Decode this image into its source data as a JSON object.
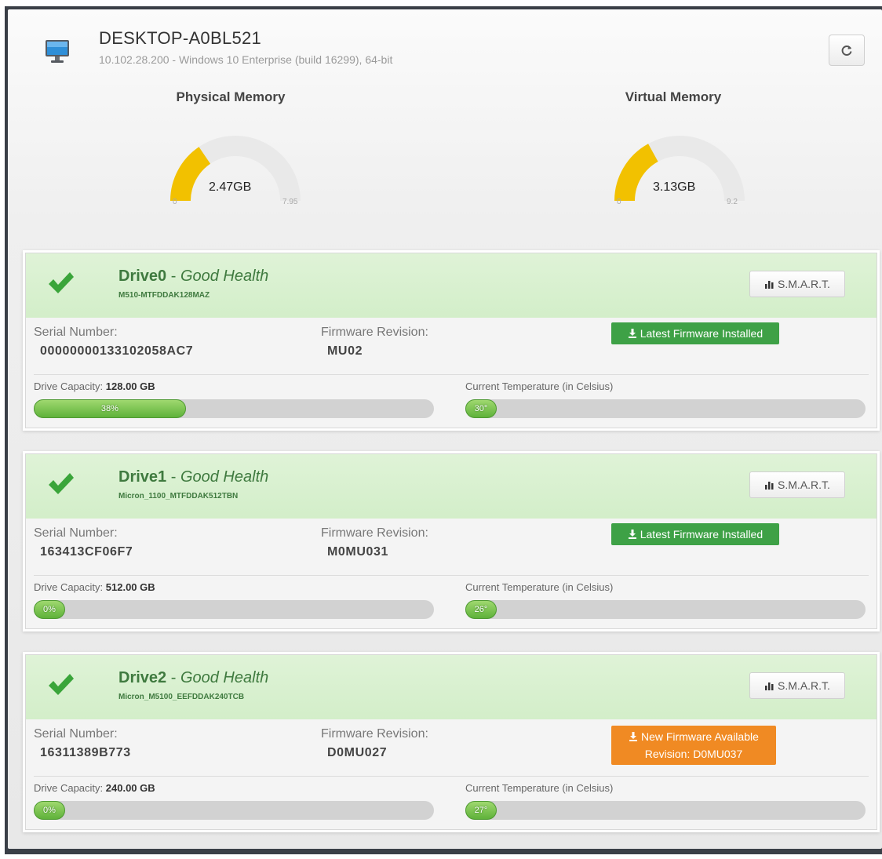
{
  "host": {
    "name": "DESKTOP-A0BL521",
    "subtitle": "10.102.28.200 - Windows 10 Enterprise (build 16299), 64-bit"
  },
  "gauges": [
    {
      "title": "Physical Memory",
      "value_label": "2.47GB",
      "min": "0",
      "max": "7.95",
      "value": 2.47,
      "max_value": 7.95,
      "color": "#f2c100"
    },
    {
      "title": "Virtual Memory",
      "value_label": "3.13GB",
      "min": "0",
      "max": "9.2",
      "value": 3.13,
      "max_value": 9.2,
      "color": "#f2c100"
    }
  ],
  "labels": {
    "serial": "Serial Number:",
    "firmware": "Firmware Revision:",
    "capacity": "Drive Capacity:",
    "temperature": "Current Temperature (in Celsius)",
    "smart": "S.M.A.R.T.",
    "separator": "-"
  },
  "drives": [
    {
      "name": "Drive0",
      "health": "Good Health",
      "model": "M510-MTFDDAK128MAZ",
      "serial": "00000000133102058AC7",
      "firmware": "MU02",
      "firmware_status": "ok",
      "firmware_badge": "Latest Firmware Installed",
      "firmware_badge_line2": "",
      "capacity": "128.00 GB",
      "usage_label": "38%",
      "usage_fraction": 0.38,
      "temp_label": "30°",
      "temp_fraction": 0.04
    },
    {
      "name": "Drive1",
      "health": "Good Health",
      "model": "Micron_1100_MTFDDAK512TBN",
      "serial": "163413CF06F7",
      "firmware": "M0MU031",
      "firmware_status": "ok",
      "firmware_badge": "Latest Firmware Installed",
      "firmware_badge_line2": "",
      "capacity": "512.00 GB",
      "usage_label": "0%",
      "usage_fraction": 0.0,
      "temp_label": "26°",
      "temp_fraction": 0.04
    },
    {
      "name": "Drive2",
      "health": "Good Health",
      "model": "Micron_M5100_EEFDDAK240TCB",
      "serial": "16311389B773",
      "firmware": "D0MU027",
      "firmware_status": "warn",
      "firmware_badge": "New Firmware Available",
      "firmware_badge_line2": "Revision: D0MU037",
      "capacity": "240.00 GB",
      "usage_label": "0%",
      "usage_fraction": 0.0,
      "temp_label": "27°",
      "temp_fraction": 0.04
    }
  ],
  "colors": {
    "good": "#3f7a3f",
    "check": "#3aa53a",
    "ok_badge": "#3ea146",
    "warn_badge": "#f08a23",
    "gauge": "#f2c100"
  }
}
